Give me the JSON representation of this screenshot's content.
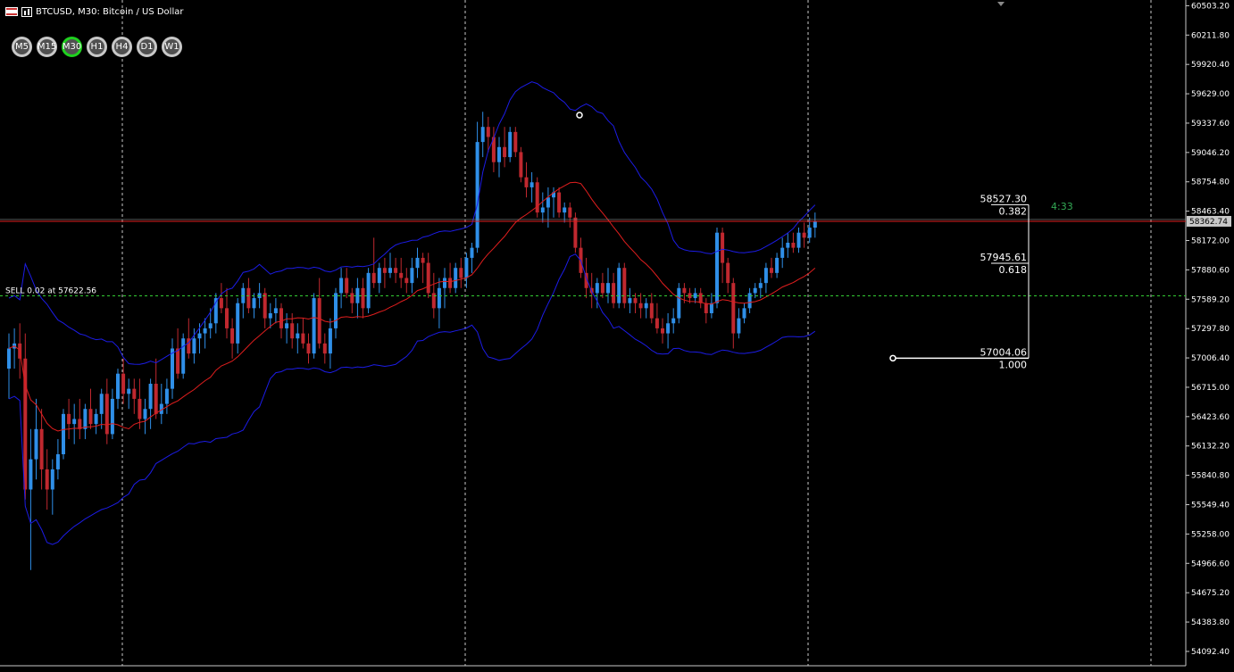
{
  "window": {
    "symbol_title": "BTCUSD, M30:  Bitcoin / US Dollar"
  },
  "timeframes": [
    {
      "label": "M5",
      "active": false
    },
    {
      "label": "M15",
      "active": false
    },
    {
      "label": "M30",
      "active": true
    },
    {
      "label": "H1",
      "active": false
    },
    {
      "label": "H4",
      "active": false
    },
    {
      "label": "D1",
      "active": false
    },
    {
      "label": "W1",
      "active": false
    }
  ],
  "colors": {
    "background": "#000000",
    "bull": "#2f8fe8",
    "bear": "#c0282f",
    "band_outer": "#1c1ce6",
    "band_mid": "#e01e1e",
    "bid_line": "#e01e1e",
    "order_line": "#33cc33",
    "countdown": "#33aa55",
    "active_tf": "#1fd11f"
  },
  "price_axis": {
    "ticks": [
      "60503.20",
      "60211.80",
      "59920.40",
      "59629.00",
      "59337.60",
      "59046.20",
      "58754.80",
      "58463.40",
      "58172.00",
      "57880.60",
      "57589.20",
      "57297.80",
      "57006.40",
      "56715.00",
      "56423.60",
      "56132.20",
      "55840.80",
      "55549.40",
      "55258.00",
      "54966.60",
      "54675.20",
      "54383.80",
      "54092.40"
    ],
    "current_price": "58362.74"
  },
  "order": {
    "label": "SELL 0.02 at 57622.56",
    "price": 57622.56
  },
  "countdown": "4:33",
  "fibo": {
    "levels": [
      {
        "price_label": "58527.30",
        "ratio": "0.382"
      },
      {
        "price_label": "57945.61",
        "ratio": "0.618"
      },
      {
        "price_label": "57004.06",
        "ratio": "1.000"
      }
    ]
  },
  "chart_data": {
    "type": "candlestick",
    "ylim": [
      53950,
      60560
    ],
    "candles": [
      {
        "o": 56900,
        "h": 57250,
        "l": 56600,
        "c": 57100
      },
      {
        "o": 57100,
        "h": 57300,
        "l": 56900,
        "c": 57150
      },
      {
        "o": 57150,
        "h": 57350,
        "l": 56800,
        "c": 57000
      },
      {
        "o": 57000,
        "h": 57250,
        "l": 55600,
        "c": 55700
      },
      {
        "o": 55700,
        "h": 56300,
        "l": 54900,
        "c": 56000
      },
      {
        "o": 56000,
        "h": 56600,
        "l": 55800,
        "c": 56300
      },
      {
        "o": 56300,
        "h": 56500,
        "l": 55700,
        "c": 55900
      },
      {
        "o": 55900,
        "h": 56100,
        "l": 55500,
        "c": 55700
      },
      {
        "o": 55700,
        "h": 56000,
        "l": 55450,
        "c": 55900
      },
      {
        "o": 55900,
        "h": 56200,
        "l": 55800,
        "c": 56050
      },
      {
        "o": 56050,
        "h": 56500,
        "l": 56000,
        "c": 56450
      },
      {
        "o": 56450,
        "h": 56600,
        "l": 56200,
        "c": 56350
      },
      {
        "o": 56350,
        "h": 56550,
        "l": 56150,
        "c": 56400
      },
      {
        "o": 56400,
        "h": 56600,
        "l": 56200,
        "c": 56300
      },
      {
        "o": 56300,
        "h": 56550,
        "l": 56200,
        "c": 56500
      },
      {
        "o": 56500,
        "h": 56700,
        "l": 56300,
        "c": 56350
      },
      {
        "o": 56350,
        "h": 56500,
        "l": 56250,
        "c": 56450
      },
      {
        "o": 56450,
        "h": 56700,
        "l": 56300,
        "c": 56650
      },
      {
        "o": 56650,
        "h": 56800,
        "l": 56150,
        "c": 56250
      },
      {
        "o": 56250,
        "h": 56700,
        "l": 56200,
        "c": 56600
      },
      {
        "o": 56600,
        "h": 56900,
        "l": 56500,
        "c": 56850
      },
      {
        "o": 56850,
        "h": 57000,
        "l": 56550,
        "c": 56650
      },
      {
        "o": 56650,
        "h": 56800,
        "l": 56500,
        "c": 56700
      },
      {
        "o": 56700,
        "h": 56800,
        "l": 56450,
        "c": 56600
      },
      {
        "o": 56600,
        "h": 56800,
        "l": 56300,
        "c": 56400
      },
      {
        "o": 56400,
        "h": 56600,
        "l": 56250,
        "c": 56500
      },
      {
        "o": 56500,
        "h": 56800,
        "l": 56300,
        "c": 56750
      },
      {
        "o": 56750,
        "h": 57000,
        "l": 56400,
        "c": 56450
      },
      {
        "o": 56450,
        "h": 56750,
        "l": 56350,
        "c": 56550
      },
      {
        "o": 56550,
        "h": 56800,
        "l": 56450,
        "c": 56700
      },
      {
        "o": 56700,
        "h": 57200,
        "l": 56600,
        "c": 57100
      },
      {
        "o": 57100,
        "h": 57300,
        "l": 56800,
        "c": 56850
      },
      {
        "o": 56850,
        "h": 57250,
        "l": 56800,
        "c": 57200
      },
      {
        "o": 57200,
        "h": 57400,
        "l": 57000,
        "c": 57050
      },
      {
        "o": 57050,
        "h": 57300,
        "l": 56950,
        "c": 57200
      },
      {
        "o": 57200,
        "h": 57350,
        "l": 57050,
        "c": 57250
      },
      {
        "o": 57250,
        "h": 57400,
        "l": 57100,
        "c": 57300
      },
      {
        "o": 57300,
        "h": 57500,
        "l": 57200,
        "c": 57350
      },
      {
        "o": 57350,
        "h": 57650,
        "l": 57250,
        "c": 57600
      },
      {
        "o": 57600,
        "h": 57750,
        "l": 57450,
        "c": 57500
      },
      {
        "o": 57500,
        "h": 57700,
        "l": 57200,
        "c": 57300
      },
      {
        "o": 57300,
        "h": 57400,
        "l": 57000,
        "c": 57150
      },
      {
        "o": 57150,
        "h": 57600,
        "l": 57050,
        "c": 57550
      },
      {
        "o": 57550,
        "h": 57750,
        "l": 57400,
        "c": 57700
      },
      {
        "o": 57700,
        "h": 57800,
        "l": 57450,
        "c": 57500
      },
      {
        "o": 57500,
        "h": 57650,
        "l": 57400,
        "c": 57600
      },
      {
        "o": 57600,
        "h": 57750,
        "l": 57500,
        "c": 57650
      },
      {
        "o": 57650,
        "h": 57700,
        "l": 57300,
        "c": 57400
      },
      {
        "o": 57400,
        "h": 57550,
        "l": 57300,
        "c": 57450
      },
      {
        "o": 57450,
        "h": 57600,
        "l": 57350,
        "c": 57500
      },
      {
        "o": 57500,
        "h": 57550,
        "l": 57200,
        "c": 57300
      },
      {
        "o": 57300,
        "h": 57450,
        "l": 57150,
        "c": 57350
      },
      {
        "o": 57350,
        "h": 57450,
        "l": 57100,
        "c": 57200
      },
      {
        "o": 57200,
        "h": 57350,
        "l": 57050,
        "c": 57250
      },
      {
        "o": 57250,
        "h": 57400,
        "l": 57100,
        "c": 57150
      },
      {
        "o": 57150,
        "h": 57250,
        "l": 56950,
        "c": 57050
      },
      {
        "o": 57050,
        "h": 57650,
        "l": 57000,
        "c": 57600
      },
      {
        "o": 57600,
        "h": 57800,
        "l": 57100,
        "c": 57150
      },
      {
        "o": 57150,
        "h": 57250,
        "l": 56950,
        "c": 57050
      },
      {
        "o": 57050,
        "h": 57400,
        "l": 56900,
        "c": 57300
      },
      {
        "o": 57300,
        "h": 57700,
        "l": 57200,
        "c": 57650
      },
      {
        "o": 57650,
        "h": 57900,
        "l": 57500,
        "c": 57800
      },
      {
        "o": 57800,
        "h": 57900,
        "l": 57600,
        "c": 57650
      },
      {
        "o": 57650,
        "h": 57700,
        "l": 57450,
        "c": 57550
      },
      {
        "o": 57550,
        "h": 57800,
        "l": 57400,
        "c": 57700
      },
      {
        "o": 57700,
        "h": 57800,
        "l": 57400,
        "c": 57500
      },
      {
        "o": 57500,
        "h": 57900,
        "l": 57450,
        "c": 57850
      },
      {
        "o": 57850,
        "h": 58200,
        "l": 57700,
        "c": 57750
      },
      {
        "o": 57750,
        "h": 57950,
        "l": 57650,
        "c": 57900
      },
      {
        "o": 57900,
        "h": 58000,
        "l": 57700,
        "c": 57850
      },
      {
        "o": 57850,
        "h": 58050,
        "l": 57800,
        "c": 57900
      },
      {
        "o": 57900,
        "h": 58000,
        "l": 57750,
        "c": 57850
      },
      {
        "o": 57850,
        "h": 58000,
        "l": 57700,
        "c": 57800
      },
      {
        "o": 57800,
        "h": 57900,
        "l": 57650,
        "c": 57750
      },
      {
        "o": 57750,
        "h": 58000,
        "l": 57650,
        "c": 57900
      },
      {
        "o": 57900,
        "h": 58100,
        "l": 57800,
        "c": 58000
      },
      {
        "o": 58000,
        "h": 58050,
        "l": 57750,
        "c": 57950
      },
      {
        "o": 57950,
        "h": 58050,
        "l": 57600,
        "c": 57650
      },
      {
        "o": 57650,
        "h": 57850,
        "l": 57400,
        "c": 57500
      },
      {
        "o": 57500,
        "h": 57800,
        "l": 57300,
        "c": 57700
      },
      {
        "o": 57700,
        "h": 57900,
        "l": 57500,
        "c": 57800
      },
      {
        "o": 57800,
        "h": 57950,
        "l": 57650,
        "c": 57700
      },
      {
        "o": 57700,
        "h": 57950,
        "l": 57650,
        "c": 57900
      },
      {
        "o": 57900,
        "h": 58000,
        "l": 57700,
        "c": 57800
      },
      {
        "o": 57800,
        "h": 58050,
        "l": 57700,
        "c": 58000
      },
      {
        "o": 58000,
        "h": 58150,
        "l": 57850,
        "c": 58100
      },
      {
        "o": 58100,
        "h": 59350,
        "l": 58050,
        "c": 59150
      },
      {
        "o": 59150,
        "h": 59450,
        "l": 59000,
        "c": 59300
      },
      {
        "o": 59300,
        "h": 59400,
        "l": 59050,
        "c": 59200
      },
      {
        "o": 59200,
        "h": 59300,
        "l": 58850,
        "c": 58950
      },
      {
        "o": 58950,
        "h": 59200,
        "l": 58800,
        "c": 59100
      },
      {
        "o": 59100,
        "h": 59300,
        "l": 58900,
        "c": 59000
      },
      {
        "o": 59000,
        "h": 59300,
        "l": 58950,
        "c": 59250
      },
      {
        "o": 59250,
        "h": 59300,
        "l": 59000,
        "c": 59050
      },
      {
        "o": 59050,
        "h": 59100,
        "l": 58750,
        "c": 58800
      },
      {
        "o": 58800,
        "h": 58950,
        "l": 58600,
        "c": 58700
      },
      {
        "o": 58700,
        "h": 58850,
        "l": 58550,
        "c": 58750
      },
      {
        "o": 58750,
        "h": 58800,
        "l": 58400,
        "c": 58450
      },
      {
        "o": 58450,
        "h": 58650,
        "l": 58350,
        "c": 58500
      },
      {
        "o": 58500,
        "h": 58700,
        "l": 58300,
        "c": 58600
      },
      {
        "o": 58600,
        "h": 58700,
        "l": 58400,
        "c": 58650
      },
      {
        "o": 58650,
        "h": 58700,
        "l": 58400,
        "c": 58450
      },
      {
        "o": 58450,
        "h": 58550,
        "l": 58350,
        "c": 58500
      },
      {
        "o": 58500,
        "h": 58550,
        "l": 58300,
        "c": 58400
      },
      {
        "o": 58400,
        "h": 58450,
        "l": 58050,
        "c": 58100
      },
      {
        "o": 58100,
        "h": 58200,
        "l": 57800,
        "c": 57850
      },
      {
        "o": 57850,
        "h": 58000,
        "l": 57600,
        "c": 57700
      },
      {
        "o": 57700,
        "h": 57850,
        "l": 57500,
        "c": 57650
      },
      {
        "o": 57650,
        "h": 57800,
        "l": 57500,
        "c": 57750
      },
      {
        "o": 57750,
        "h": 57850,
        "l": 57600,
        "c": 57650
      },
      {
        "o": 57650,
        "h": 57900,
        "l": 57550,
        "c": 57750
      },
      {
        "o": 57750,
        "h": 57850,
        "l": 57500,
        "c": 57550
      },
      {
        "o": 57550,
        "h": 57950,
        "l": 57500,
        "c": 57900
      },
      {
        "o": 57900,
        "h": 57950,
        "l": 57500,
        "c": 57550
      },
      {
        "o": 57550,
        "h": 57700,
        "l": 57450,
        "c": 57600
      },
      {
        "o": 57600,
        "h": 57650,
        "l": 57450,
        "c": 57550
      },
      {
        "o": 57550,
        "h": 57650,
        "l": 57400,
        "c": 57500
      },
      {
        "o": 57500,
        "h": 57600,
        "l": 57400,
        "c": 57550
      },
      {
        "o": 57550,
        "h": 57650,
        "l": 57350,
        "c": 57400
      },
      {
        "o": 57400,
        "h": 57550,
        "l": 57250,
        "c": 57300
      },
      {
        "o": 57300,
        "h": 57400,
        "l": 57150,
        "c": 57250
      },
      {
        "o": 57250,
        "h": 57450,
        "l": 57100,
        "c": 57350
      },
      {
        "o": 57350,
        "h": 57500,
        "l": 57250,
        "c": 57400
      },
      {
        "o": 57400,
        "h": 57750,
        "l": 57350,
        "c": 57700
      },
      {
        "o": 57700,
        "h": 57750,
        "l": 57550,
        "c": 57650
      },
      {
        "o": 57650,
        "h": 57700,
        "l": 57550,
        "c": 57600
      },
      {
        "o": 57600,
        "h": 57700,
        "l": 57550,
        "c": 57650
      },
      {
        "o": 57650,
        "h": 57700,
        "l": 57500,
        "c": 57550
      },
      {
        "o": 57550,
        "h": 57600,
        "l": 57350,
        "c": 57450
      },
      {
        "o": 57450,
        "h": 57650,
        "l": 57400,
        "c": 57550
      },
      {
        "o": 57550,
        "h": 58300,
        "l": 57500,
        "c": 58250
      },
      {
        "o": 58250,
        "h": 58300,
        "l": 57750,
        "c": 57950
      },
      {
        "o": 57950,
        "h": 58000,
        "l": 57650,
        "c": 57750
      },
      {
        "o": 57750,
        "h": 57800,
        "l": 57100,
        "c": 57250
      },
      {
        "o": 57250,
        "h": 57500,
        "l": 57200,
        "c": 57400
      },
      {
        "o": 57400,
        "h": 57550,
        "l": 57350,
        "c": 57500
      },
      {
        "o": 57500,
        "h": 57700,
        "l": 57450,
        "c": 57650
      },
      {
        "o": 57650,
        "h": 57750,
        "l": 57600,
        "c": 57700
      },
      {
        "o": 57700,
        "h": 57800,
        "l": 57600,
        "c": 57750
      },
      {
        "o": 57750,
        "h": 57950,
        "l": 57650,
        "c": 57900
      },
      {
        "o": 57900,
        "h": 58000,
        "l": 57800,
        "c": 57850
      },
      {
        "o": 57850,
        "h": 58050,
        "l": 57800,
        "c": 58000
      },
      {
        "o": 58000,
        "h": 58200,
        "l": 57900,
        "c": 58100
      },
      {
        "o": 58100,
        "h": 58250,
        "l": 58000,
        "c": 58150
      },
      {
        "o": 58150,
        "h": 58250,
        "l": 58050,
        "c": 58100
      },
      {
        "o": 58100,
        "h": 58300,
        "l": 58050,
        "c": 58250
      },
      {
        "o": 58250,
        "h": 58350,
        "l": 58100,
        "c": 58200
      },
      {
        "o": 58200,
        "h": 58400,
        "l": 58150,
        "c": 58300
      },
      {
        "o": 58300,
        "h": 58450,
        "l": 58200,
        "c": 58362.74
      }
    ]
  }
}
